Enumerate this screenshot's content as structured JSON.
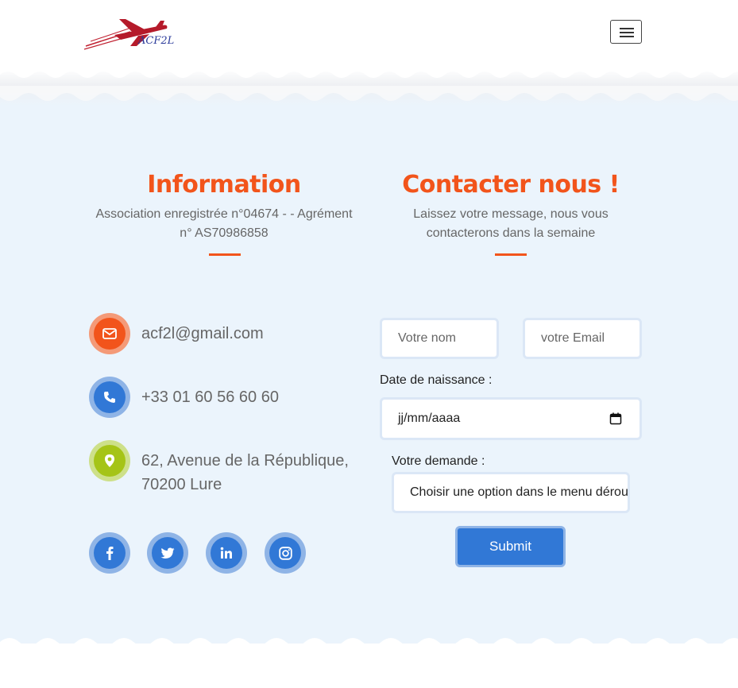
{
  "header": {
    "logo_text": "ACF2L",
    "menu_label": "menu"
  },
  "information": {
    "title": "Information",
    "subtitle_line1": "Association enregistrée n°04674 - - Agrément",
    "subtitle_line2": "n° AS70986858"
  },
  "contact_section": {
    "title": "Contacter nous !",
    "subtitle_line1": "Laissez votre message, nous vous",
    "subtitle_line2": "contacterons dans la semaine"
  },
  "contact_info": {
    "email": "acf2l@gmail.com",
    "phone": "+33 01 60 56 60 60",
    "address_line1": "62, Avenue de la République,",
    "address_line2": "70200 Lure"
  },
  "social": [
    {
      "icon": "facebook-icon"
    },
    {
      "icon": "twitter-icon"
    },
    {
      "icon": "linkedin-icon"
    },
    {
      "icon": "instagram-icon"
    }
  ],
  "form": {
    "name_placeholder": "Votre nom",
    "email_placeholder": "votre Email",
    "birthdate_label": "Date de naissance :",
    "birthdate_value": "jj/mm/aaaa",
    "request_label": "Votre demande :",
    "request_value": "Choisir une option dans le menu déroulant",
    "submit_label": "Submit"
  },
  "colors": {
    "accent_orange": "#f2541b",
    "primary_blue": "#3178d6",
    "lime": "#a5c417",
    "section_bg": "#ebf4fc"
  }
}
